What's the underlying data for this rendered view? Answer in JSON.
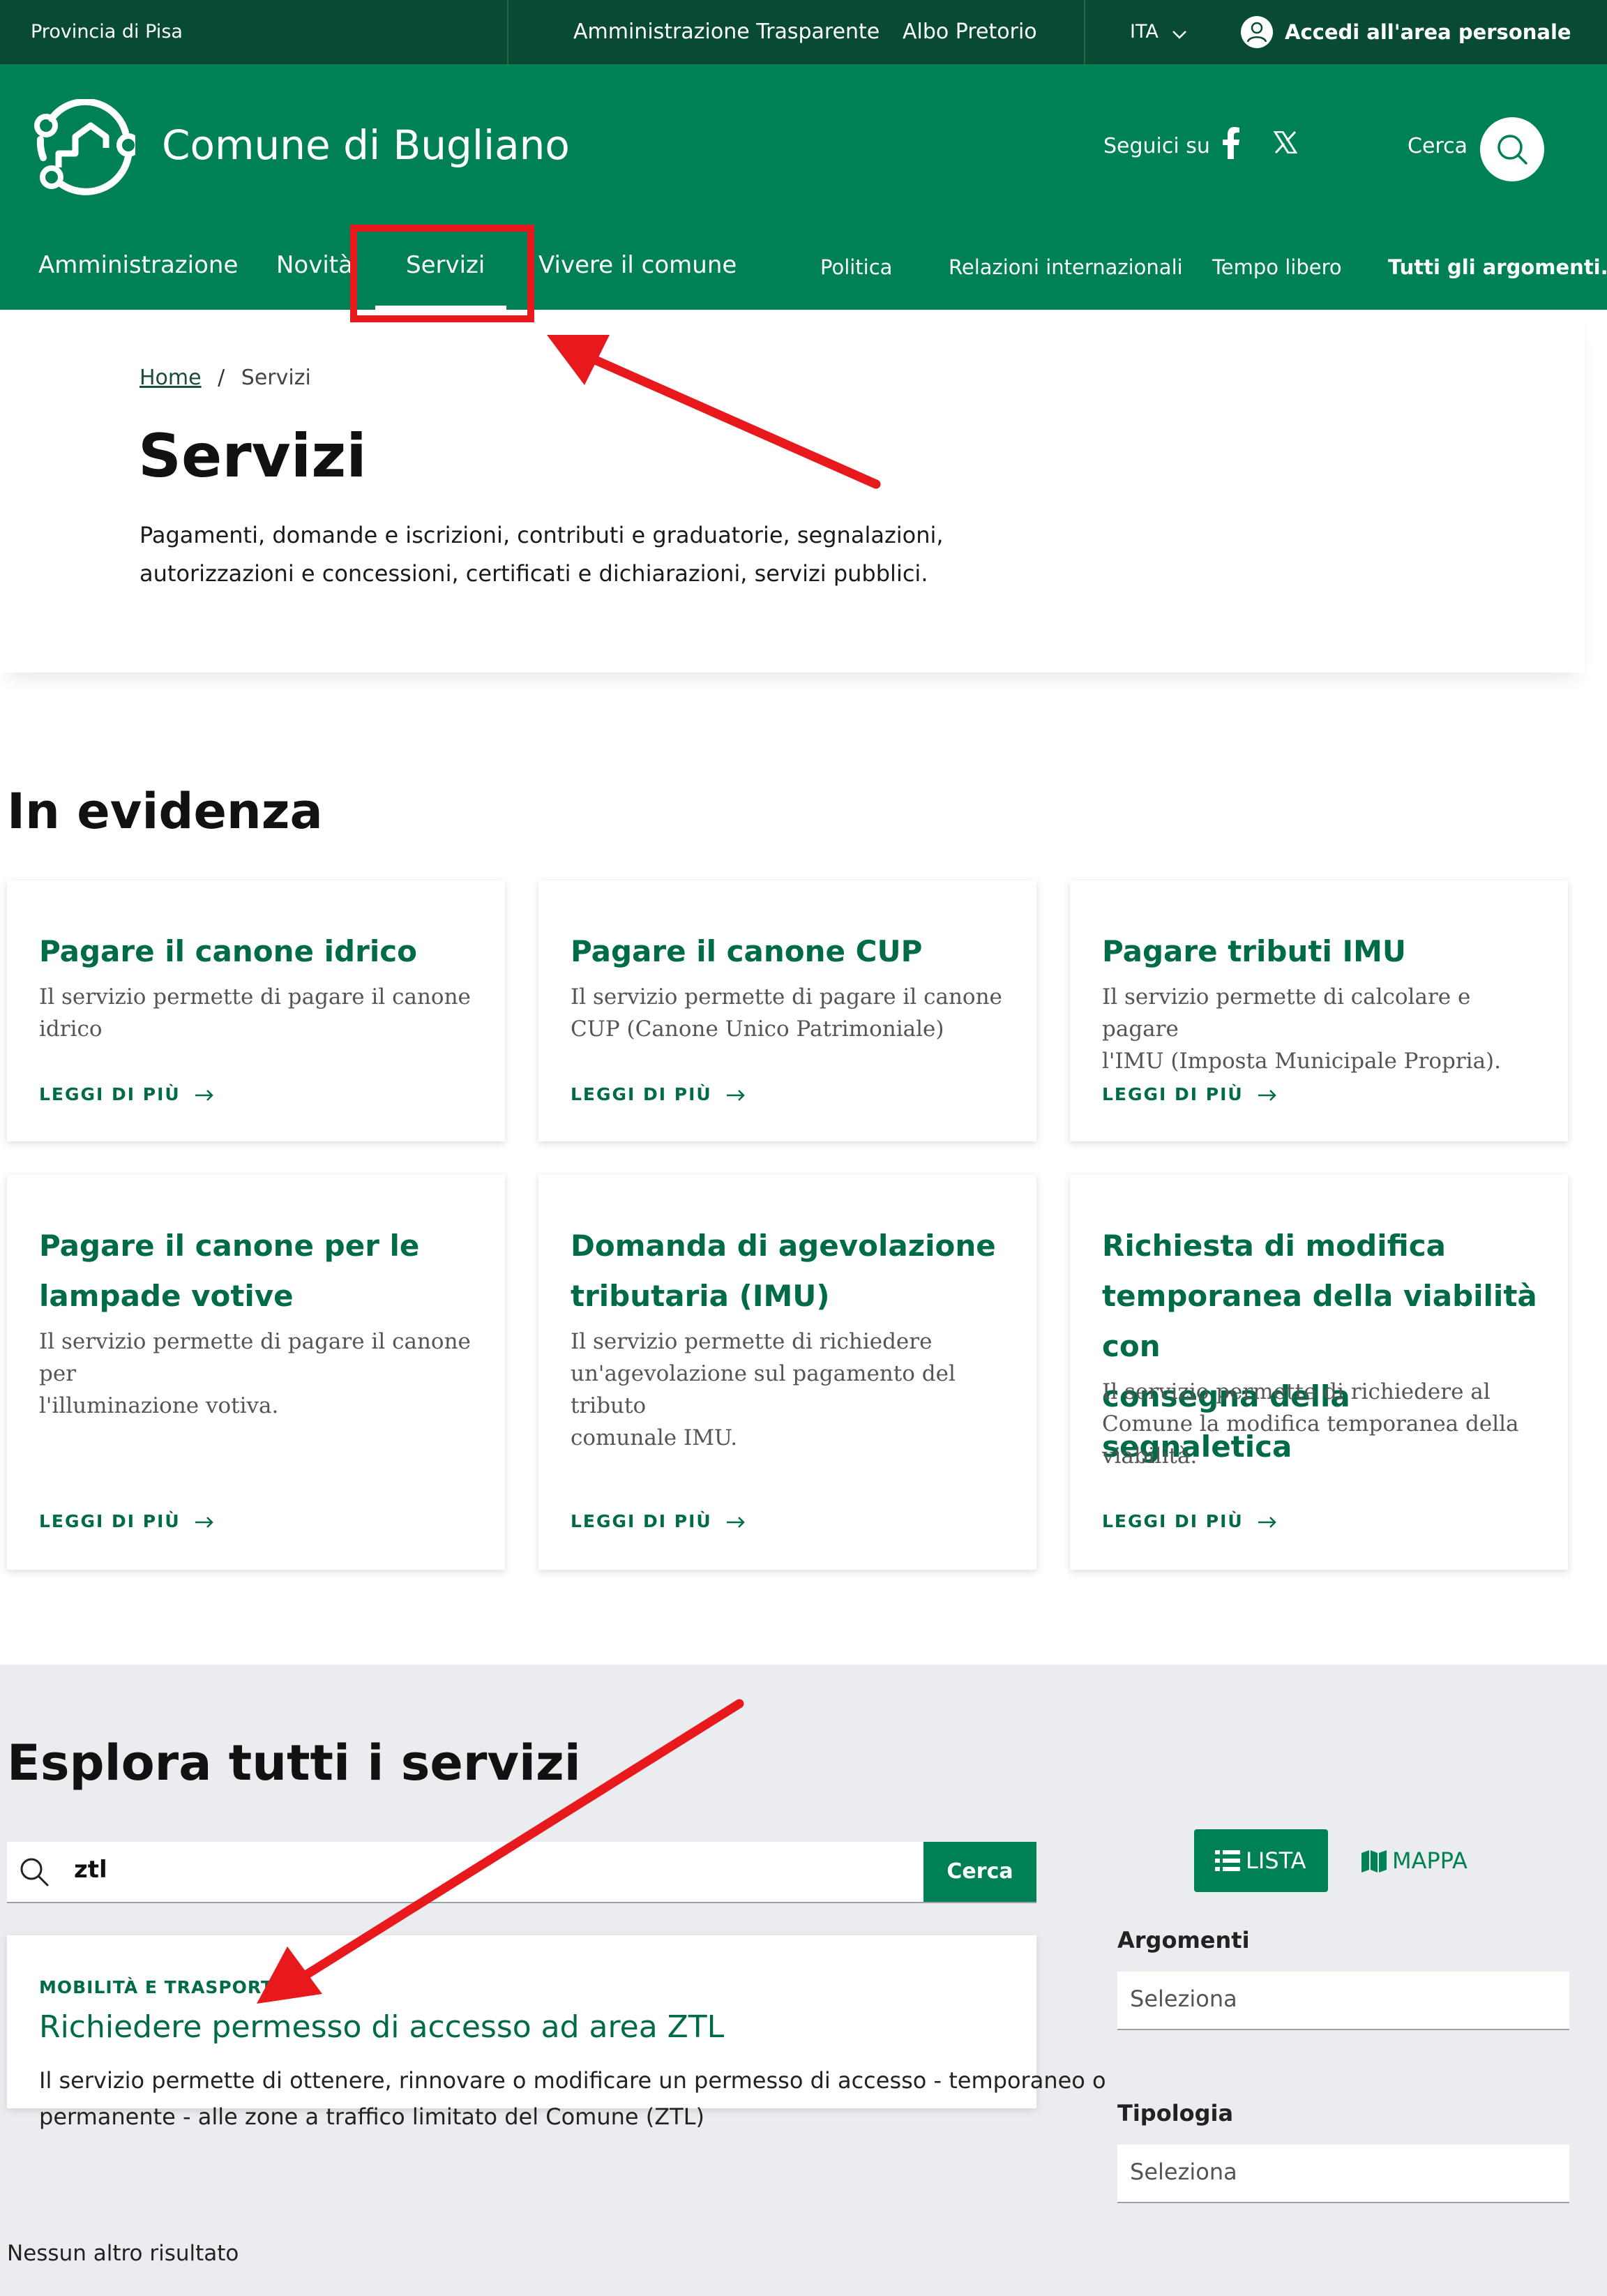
{
  "slim_header": {
    "region": "Provincia di Pisa",
    "links": [
      "Amministrazione Trasparente",
      "Albo Pretorio"
    ],
    "language": "ITA",
    "login_label": "Accedi all'area personale"
  },
  "header": {
    "site_title": "Comune di Bugliano",
    "social_label": "Seguici su",
    "social": [
      "facebook-icon",
      "x-icon"
    ],
    "search_label": "Cerca"
  },
  "nav": {
    "main": [
      "Amministrazione",
      "Novità",
      "Servizi",
      "Vivere il comune"
    ],
    "active": "Servizi",
    "secondary": [
      "Politica",
      "Relazioni internazionali",
      "Tempo libero"
    ],
    "all_topics": "Tutti gli argomenti..."
  },
  "breadcrumb": {
    "home": "Home",
    "separator": "/",
    "current": "Servizi"
  },
  "hero": {
    "title": "Servizi",
    "description_line1": "Pagamenti, domande e iscrizioni, contributi e graduatorie, segnalazioni,",
    "description_line2": "autorizzazioni e concessioni, certificati e dichiarazioni, servizi pubblici."
  },
  "featured": {
    "heading": "In evidenza",
    "read_more": "LEGGI DI PIÙ",
    "cards": [
      {
        "title_lines": [
          "Pagare il canone idrico"
        ],
        "desc_lines": [
          "Il servizio permette di pagare il canone",
          "idrico"
        ]
      },
      {
        "title_lines": [
          "Pagare il canone CUP"
        ],
        "desc_lines": [
          "Il servizio permette di pagare il canone",
          "CUP (Canone Unico Patrimoniale)"
        ]
      },
      {
        "title_lines": [
          "Pagare tributi IMU"
        ],
        "desc_lines": [
          "Il servizio permette di calcolare e pagare",
          "l'IMU (Imposta Municipale Propria)."
        ]
      },
      {
        "title_lines": [
          "Pagare il canone per le",
          "lampade votive"
        ],
        "desc_lines": [
          "Il servizio permette di pagare il canone per",
          "l'illuminazione votiva."
        ]
      },
      {
        "title_lines": [
          "Domanda di agevolazione",
          "tributaria (IMU)"
        ],
        "desc_lines": [
          "Il servizio permette di richiedere",
          "un'agevolazione sul pagamento del tributo",
          "comunale IMU."
        ]
      },
      {
        "title_lines": [
          "Richiesta di modifica",
          "temporanea della viabilità con",
          "consegna della segnaletica"
        ],
        "desc_lines": [
          "Il servizio permette di richiedere al",
          "Comune la modifica temporanea della",
          "viabilità."
        ]
      }
    ]
  },
  "explore": {
    "heading": "Esplora tutti i servizi",
    "search_value": "ztl",
    "search_button": "Cerca",
    "view_list": "LISTA",
    "view_map": "MAPPA",
    "result": {
      "category": "MOBILITÀ E TRASPORTI",
      "title": "Richiedere permesso di accesso ad area ZTL",
      "desc_line1": "Il servizio permette di ottenere, rinnovare o modificare un permesso di accesso - temporaneo o",
      "desc_line2": "permanente - alle zone a traffico limitato del Comune (ZTL)"
    },
    "no_more_results": "Nessun altro risultato",
    "filters": [
      {
        "label": "Argomenti",
        "placeholder": "Seleziona"
      },
      {
        "label": "Tipologia",
        "placeholder": "Seleziona"
      }
    ]
  },
  "colors": {
    "primary": "#008055",
    "dark": "#084b32",
    "accent_text": "#006b47",
    "annotation": "#e8191c"
  }
}
